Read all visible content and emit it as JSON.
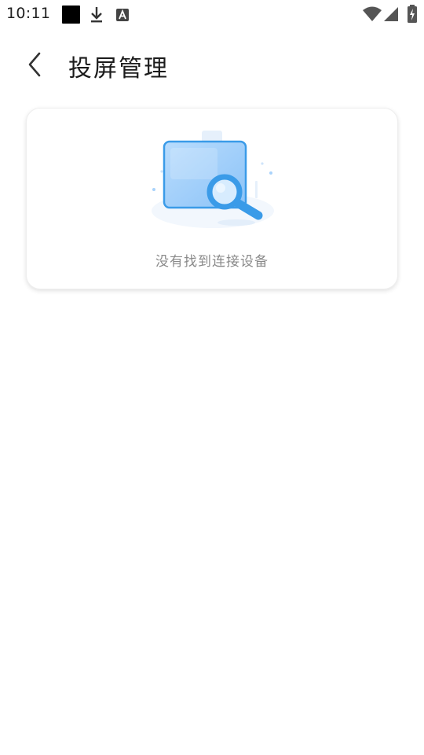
{
  "status_bar": {
    "time": "10:11",
    "icons": [
      "notification-square-icon",
      "download-icon",
      "a-badge-icon",
      "wifi-icon",
      "signal-icon",
      "battery-charging-icon"
    ]
  },
  "header": {
    "back_icon": "chevron-left-icon",
    "title": "投屏管理"
  },
  "empty_state": {
    "illustration": "screen-search-icon",
    "message": "没有找到连接设备"
  },
  "colors": {
    "title": "#1c1c1c",
    "message": "#8a8a8a",
    "accent": "#3a9be8",
    "accent_light": "#a9d3fb"
  }
}
